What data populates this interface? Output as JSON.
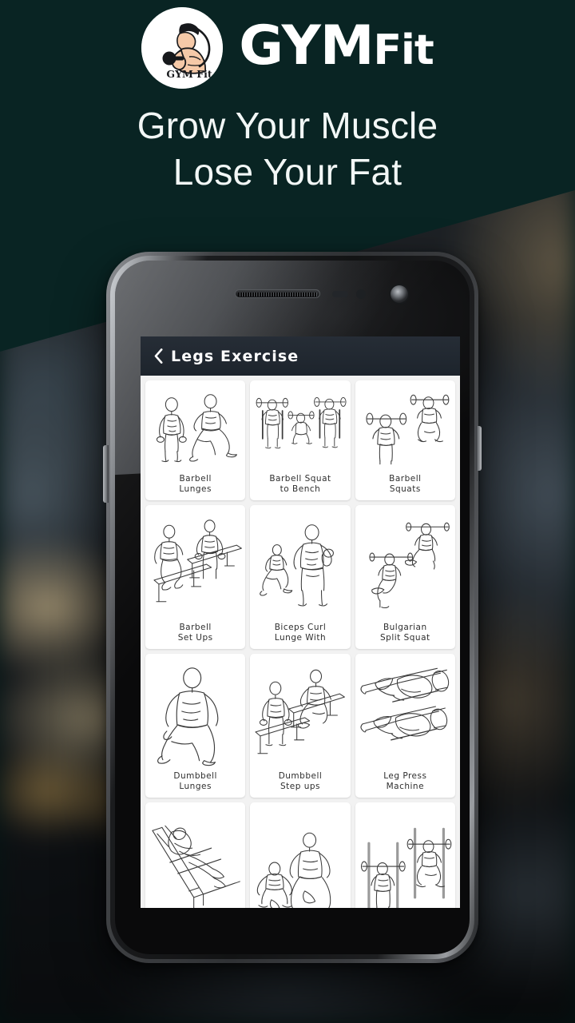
{
  "brand": {
    "logo_badge_text": "GYM Fit",
    "name_part1": "GYM",
    "name_part2": "Fit",
    "teal_bg_color": "#092423",
    "text_color": "#ffffff"
  },
  "tagline": {
    "line1": "Grow Your Muscle",
    "line2": "Lose Your Fat"
  },
  "app": {
    "bar": {
      "back_label": "‹",
      "title": "Legs Exercise",
      "bar_color": "#1e252e"
    },
    "grid": {
      "rows": [
        {
          "cards": [
            {
              "label_line1": "Barbell",
              "label_line2": "Lunges",
              "art": "barbell-lunges"
            },
            {
              "label_line1": "Barbell Squat",
              "label_line2": "to Bench",
              "art": "barbell-squat-to-bench"
            },
            {
              "label_line1": "Barbell",
              "label_line2": "Squats",
              "art": "barbell-squats"
            }
          ]
        },
        {
          "cards": [
            {
              "label_line1": "Barbell",
              "label_line2": "Set Ups",
              "art": "barbell-set-ups"
            },
            {
              "label_line1": "Biceps Curl",
              "label_line2": "Lunge With",
              "art": "biceps-curl-lunge"
            },
            {
              "label_line1": "Bulgarian",
              "label_line2": "Split Squat",
              "art": "bulgarian-split-squat"
            }
          ]
        },
        {
          "cards": [
            {
              "label_line1": "Dumbbell",
              "label_line2": "Lunges",
              "art": "dumbbell-lunges"
            },
            {
              "label_line1": "Dumbbell",
              "label_line2": "Step ups",
              "art": "dumbbell-step-ups"
            },
            {
              "label_line1": "Leg Press",
              "label_line2": "Machine",
              "art": "leg-press-machine"
            }
          ]
        },
        {
          "cards": [
            {
              "label_line1": "",
              "label_line2": "",
              "art": "hack-squat-machine"
            },
            {
              "label_line1": "",
              "label_line2": "",
              "art": "sumo-squat"
            },
            {
              "label_line1": "",
              "label_line2": "",
              "art": "smith-machine-squat"
            }
          ]
        }
      ]
    }
  },
  "device": {
    "hardware": {
      "earpiece": "earpiece-speaker",
      "front_camera": "front-camera",
      "proximity_sensor": "proximity-sensor",
      "volume_button": "volume-rocker",
      "power_button": "power-button"
    }
  }
}
